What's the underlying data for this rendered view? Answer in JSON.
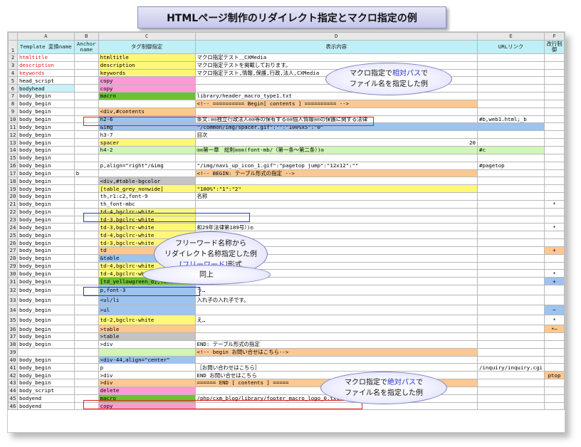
{
  "title": "HTMLページ制作のリダイレクト指定とマクロ指定の例",
  "columns": [
    "A",
    "B",
    "C",
    "D",
    "E",
    "F"
  ],
  "header": {
    "row_no": "1",
    "a": "Template 変換name",
    "b": "Anchor name",
    "c": "タグ制御指定",
    "d": "表示内容",
    "e": "URLリンク",
    "f": "改行制御"
  },
  "rows": [
    {
      "n": "2",
      "a": "htmltitle",
      "c": "htmltitle",
      "d": "マクロ指定テスト＿CXMedia",
      "e": "",
      "f": ""
    },
    {
      "n": "3",
      "a": "description",
      "c": "description",
      "d": "マクロ指定テストを掲載しております。",
      "e": "",
      "f": ""
    },
    {
      "n": "4",
      "a": "keywords",
      "c": "keywords",
      "d": "マクロ指定テスト,情報,保護,行政,法人,CXMedia",
      "e": "",
      "f": ""
    },
    {
      "n": "5",
      "a": "head_script",
      "c": "copy",
      "d": "",
      "e": "",
      "f": ""
    },
    {
      "n": "6",
      "a": "bodyhead",
      "c": "copy",
      "d": "",
      "e": "",
      "f": ""
    },
    {
      "n": "7",
      "a": "body_begin",
      "c": "macro",
      "d": "library/header_macro_type1.txt",
      "e": "",
      "f": ""
    },
    {
      "n": "8",
      "a": "body_begin",
      "c": "",
      "d": "<!-- ========== Begin[ contents ] ========== -->",
      "e": "",
      "f": ""
    },
    {
      "n": "9",
      "a": "body_begin",
      "c": "<div,#contents",
      "d": "",
      "e": "",
      "f": ""
    },
    {
      "n": "10",
      "a": "body_begin",
      "c": "h2-6",
      "d": "条文:◎◎独立行政法人◎◎等の保有する◎◎個人情報◎◎の保護に関する法律",
      "e": "#b,web1.html;_b",
      "f": ""
    },
    {
      "n": "11",
      "a": "body_begin",
      "c": "&img",
      "d": "\"/common/img/spacer.gif\":\"\":\"100%x5\":\"0\"",
      "e": "",
      "f": ""
    },
    {
      "n": "12",
      "a": "body_begin",
      "c": "h3-7",
      "d": "目次",
      "e": "",
      "f": ""
    },
    {
      "n": "13",
      "a": "body_begin",
      "c": "spacer",
      "d": "20",
      "e": "",
      "f": ""
    },
    {
      "n": "14",
      "a": "body_begin",
      "c": "h4-2",
      "d": "◎◎第一章　総則◎◎◎(font-mb/（第一条～第二条）)◎",
      "e": "#c",
      "f": ""
    },
    {
      "n": "15",
      "a": "body_begin",
      "c": "",
      "d": "",
      "e": "",
      "f": ""
    },
    {
      "n": "16",
      "a": "body_begin",
      "c": "p,align=\"right\"/&img",
      "d": "\"/img/navi_up_icon_1.gif\":\"pagetop jump\":\"12x12\":\"\"",
      "e": "#pagetop",
      "f": ""
    },
    {
      "n": "17",
      "a": "body_begin",
      "b": "b",
      "c": "",
      "d": "<!-- BEGIN: テーブル形式の指定 -->",
      "e": "",
      "f": ""
    },
    {
      "n": "18",
      "a": "body_begin",
      "c": "<div,#table-bgcolor",
      "d": "",
      "e": "",
      "f": ""
    },
    {
      "n": "19",
      "a": "body_begin",
      "c": "[table_grey_nonwide]",
      "d": "\"100%\":\"1\":\"2\"",
      "e": "",
      "f": ""
    },
    {
      "n": "20",
      "a": "body_begin",
      "c": "th,r1:c2,font-9",
      "d": "名称",
      "e": "",
      "f": ""
    },
    {
      "n": "21",
      "a": "body_begin",
      "c": "th_font-mbc",
      "d": "",
      "e": "",
      "f": "*"
    },
    {
      "n": "22",
      "a": "body_begin",
      "c": "td-4,bgclrc-white",
      "d": "",
      "e": "",
      "f": ""
    },
    {
      "n": "23",
      "a": "body_begin",
      "c": "td-3,bgclrc-white",
      "d": "",
      "e": "",
      "f": ""
    },
    {
      "n": "24",
      "a": "body_begin",
      "c": "td-3,bgclrc-white",
      "d": "和29年法律第189号）)◎",
      "e": "",
      "f": "*"
    },
    {
      "n": "25",
      "a": "body_begin",
      "c": "td-4,bgclrc-white",
      "d": "",
      "e": "",
      "f": ""
    },
    {
      "n": "26",
      "a": "body_begin",
      "c": "td-3,bgclrc-white",
      "d": "7年法律第31号)",
      "e": "",
      "f": ""
    },
    {
      "n": "27",
      "a": "body_begin",
      "c": "td",
      "d": "",
      "e": "",
      "f": "+"
    },
    {
      "n": "28",
      "a": "body_begin",
      "c": "&table",
      "d": "",
      "e": "",
      "f": ""
    },
    {
      "n": "29",
      "a": "body_begin",
      "c": "td-4,bgclrc-white",
      "d": "",
      "e": "",
      "f": ""
    },
    {
      "n": "30",
      "a": "body_begin",
      "c": "td-4,bgclrc-white",
      "d": "",
      "e": "",
      "f": "*"
    },
    {
      "n": "31",
      "a": "body_begin",
      "c": "[td_yellowgreen_d],font-mb",
      "d": "",
      "e": "",
      "f": "+"
    },
    {
      "n": "32",
      "a": "body_begin",
      "c": "p,font-3",
      "d": "う…",
      "e": "",
      "f": ""
    },
    {
      "n": "33",
      "a": "body_begin",
      "c": "<ul/li",
      "d": "入れ子の入れ子です。",
      "e": "",
      "f": ""
    },
    {
      "n": "34",
      "a": "body_begin",
      "c": ">ul",
      "d": "",
      "e": "",
      "f": "−"
    },
    {
      "n": "35",
      "a": "body_begin",
      "c": "td-2,bgclrc-white",
      "d": "え…",
      "e": "",
      "f": "*"
    },
    {
      "n": "36",
      "a": "body_begin",
      "c": ">table",
      "d": "",
      "e": "",
      "f": "*−"
    },
    {
      "n": "37",
      "a": "body_begin",
      "c": ">table",
      "d": "",
      "e": "",
      "f": ""
    },
    {
      "n": "38",
      "a": "body_begin",
      "c": ">div",
      "d": "END: テーブル形式の指定",
      "e": "",
      "f": ""
    },
    {
      "n": "39",
      "a": "",
      "c": "",
      "d": "<!-- begin お問い合せはこちら-->",
      "e": "",
      "f": ""
    },
    {
      "n": "40",
      "a": "body_begin",
      "c": "<div-44,align=\"center\"",
      "d": "",
      "e": "",
      "f": ""
    },
    {
      "n": "41",
      "a": "body_begin",
      "c": "p",
      "d": "［お問い合わせはこちら］",
      "e": "/inquiry/inquiry.cgi",
      "f": ""
    },
    {
      "n": "42",
      "a": "body_begin",
      "c": ">div",
      "d": "END お問い合せはこちら",
      "e": "",
      "f": "ptop"
    },
    {
      "n": "43",
      "a": "body_begin",
      "c": ">div",
      "d": "====== END [ contents ] =====",
      "e": "",
      "f": ""
    },
    {
      "n": "44",
      "a": "body_script",
      "c": "delete",
      "d": "",
      "e": "",
      "f": ""
    },
    {
      "n": "45",
      "a": "bodyend",
      "c": "macro",
      "d": "/php/cxm_blog/library/footer_macro_logo_0.txt",
      "e": "",
      "f": ""
    },
    {
      "n": "46",
      "a": "bodyend",
      "c": "copy",
      "d": "",
      "e": "",
      "f": ""
    }
  ],
  "callouts": {
    "relative": {
      "line1_pre": "マクロ指定で",
      "line1_hl": "相対パス",
      "line1_post": "で",
      "line2": "ファイル名を指定した例"
    },
    "freeword": {
      "line1": "フリーワード名称から",
      "line2": "リダイレクト名称指定した例",
      "line3_hl": "[フリーワード]",
      "line3_post": "形式"
    },
    "same": {
      "text": "同上"
    },
    "absolute": {
      "line1_pre": "マクロ指定で",
      "line1_hl": "絶対パス",
      "line1_post": "で",
      "line2": "ファイル名を指定した例"
    }
  },
  "colors": {
    "yellow": "#fff77a",
    "pink": "#ff9ad4",
    "blue": "#9dc3ef",
    "green": "#6ec232",
    "orange": "#ffc890",
    "light_green": "#d2f5b8",
    "cyan": "#c8f1fa",
    "red_text": "#e0201a",
    "callout_border": "#7a7ec0",
    "highlight_text": "#2a35c8"
  }
}
